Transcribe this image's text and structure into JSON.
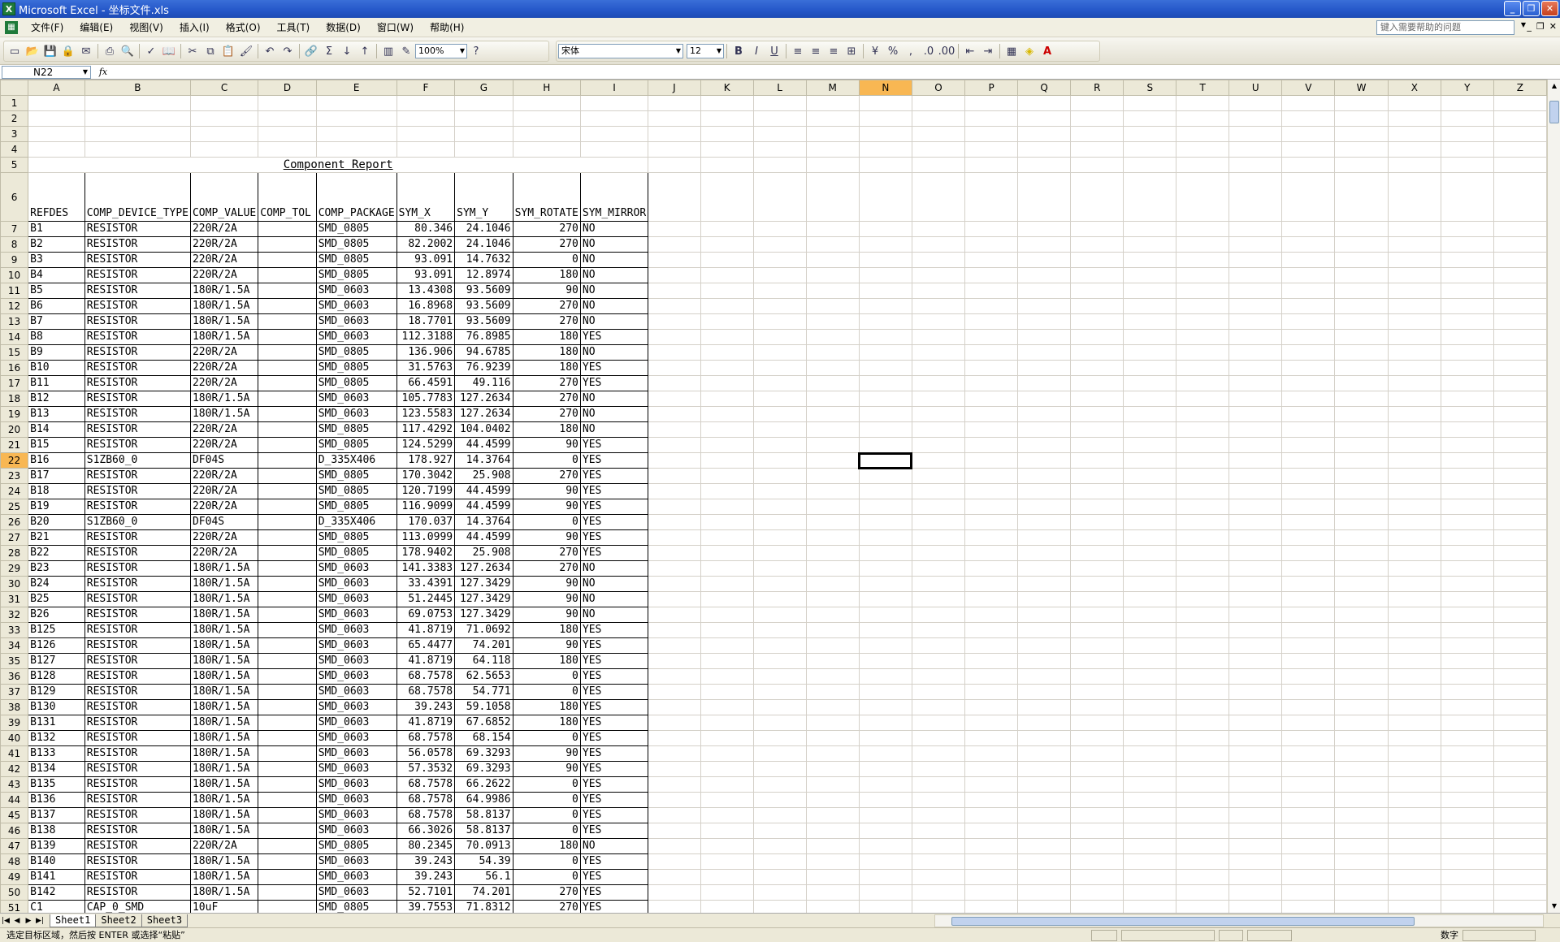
{
  "window": {
    "title": "Microsoft Excel - 坐标文件.xls",
    "app_icon": "excel-icon"
  },
  "menus": [
    "文件(F)",
    "编辑(E)",
    "视图(V)",
    "插入(I)",
    "格式(O)",
    "工具(T)",
    "数据(D)",
    "窗口(W)",
    "帮助(H)"
  ],
  "help_placeholder": "键入需要帮助的问题",
  "toolbar": {
    "zoom": "100%",
    "font": "宋体",
    "size": "12"
  },
  "formula": {
    "name_box": "N22",
    "fx": "fx",
    "value": ""
  },
  "columns": [
    "A",
    "B",
    "C",
    "D",
    "E",
    "F",
    "G",
    "H",
    "I",
    "J",
    "K",
    "L",
    "M",
    "N",
    "O",
    "P",
    "Q",
    "R",
    "S",
    "T",
    "U",
    "V",
    "W",
    "X",
    "Y",
    "Z"
  ],
  "selected_column": "N",
  "selected_row": 22,
  "report_title": "Component Report",
  "headers": [
    "REFDES",
    "COMP_DEVICE_TYPE",
    "COMP_VALUE",
    "COMP_TOL",
    "COMP_PACKAGE",
    "SYM_X",
    "SYM_Y",
    "SYM_ROTATE",
    "SYM_MIRROR"
  ],
  "rows": [
    [
      "B1",
      "RESISTOR",
      "220R/2A",
      "",
      "SMD_0805",
      "80.346",
      "24.1046",
      "270",
      "NO"
    ],
    [
      "B2",
      "RESISTOR",
      "220R/2A",
      "",
      "SMD_0805",
      "82.2002",
      "24.1046",
      "270",
      "NO"
    ],
    [
      "B3",
      "RESISTOR",
      "220R/2A",
      "",
      "SMD_0805",
      "93.091",
      "14.7632",
      "0",
      "NO"
    ],
    [
      "B4",
      "RESISTOR",
      "220R/2A",
      "",
      "SMD_0805",
      "93.091",
      "12.8974",
      "180",
      "NO"
    ],
    [
      "B5",
      "RESISTOR",
      "180R/1.5A",
      "",
      "SMD_0603",
      "13.4308",
      "93.5609",
      "90",
      "NO"
    ],
    [
      "B6",
      "RESISTOR",
      "180R/1.5A",
      "",
      "SMD_0603",
      "16.8968",
      "93.5609",
      "270",
      "NO"
    ],
    [
      "B7",
      "RESISTOR",
      "180R/1.5A",
      "",
      "SMD_0603",
      "18.7701",
      "93.5609",
      "270",
      "NO"
    ],
    [
      "B8",
      "RESISTOR",
      "180R/1.5A",
      "",
      "SMD_0603",
      "112.3188",
      "76.8985",
      "180",
      "YES"
    ],
    [
      "B9",
      "RESISTOR",
      "220R/2A",
      "",
      "SMD_0805",
      "136.906",
      "94.6785",
      "180",
      "NO"
    ],
    [
      "B10",
      "RESISTOR",
      "220R/2A",
      "",
      "SMD_0805",
      "31.5763",
      "76.9239",
      "180",
      "YES"
    ],
    [
      "B11",
      "RESISTOR",
      "220R/2A",
      "",
      "SMD_0805",
      "66.4591",
      "49.116",
      "270",
      "YES"
    ],
    [
      "B12",
      "RESISTOR",
      "180R/1.5A",
      "",
      "SMD_0603",
      "105.7783",
      "127.2634",
      "270",
      "NO"
    ],
    [
      "B13",
      "RESISTOR",
      "180R/1.5A",
      "",
      "SMD_0603",
      "123.5583",
      "127.2634",
      "270",
      "NO"
    ],
    [
      "B14",
      "RESISTOR",
      "220R/2A",
      "",
      "SMD_0805",
      "117.4292",
      "104.0402",
      "180",
      "NO"
    ],
    [
      "B15",
      "RESISTOR",
      "220R/2A",
      "",
      "SMD_0805",
      "124.5299",
      "44.4599",
      "90",
      "YES"
    ],
    [
      "B16",
      "S1ZB60_0",
      "DF04S",
      "",
      "D_335X406",
      "178.927",
      "14.3764",
      "0",
      "YES"
    ],
    [
      "B17",
      "RESISTOR",
      "220R/2A",
      "",
      "SMD_0805",
      "170.3042",
      "25.908",
      "270",
      "YES"
    ],
    [
      "B18",
      "RESISTOR",
      "220R/2A",
      "",
      "SMD_0805",
      "120.7199",
      "44.4599",
      "90",
      "YES"
    ],
    [
      "B19",
      "RESISTOR",
      "220R/2A",
      "",
      "SMD_0805",
      "116.9099",
      "44.4599",
      "90",
      "YES"
    ],
    [
      "B20",
      "S1ZB60_0",
      "DF04S",
      "",
      "D_335X406",
      "170.037",
      "14.3764",
      "0",
      "YES"
    ],
    [
      "B21",
      "RESISTOR",
      "220R/2A",
      "",
      "SMD_0805",
      "113.0999",
      "44.4599",
      "90",
      "YES"
    ],
    [
      "B22",
      "RESISTOR",
      "220R/2A",
      "",
      "SMD_0805",
      "178.9402",
      "25.908",
      "270",
      "YES"
    ],
    [
      "B23",
      "RESISTOR",
      "180R/1.5A",
      "",
      "SMD_0603",
      "141.3383",
      "127.2634",
      "270",
      "NO"
    ],
    [
      "B24",
      "RESISTOR",
      "180R/1.5A",
      "",
      "SMD_0603",
      "33.4391",
      "127.3429",
      "90",
      "NO"
    ],
    [
      "B25",
      "RESISTOR",
      "180R/1.5A",
      "",
      "SMD_0603",
      "51.2445",
      "127.3429",
      "90",
      "NO"
    ],
    [
      "B26",
      "RESISTOR",
      "180R/1.5A",
      "",
      "SMD_0603",
      "69.0753",
      "127.3429",
      "90",
      "NO"
    ],
    [
      "B125",
      "RESISTOR",
      "180R/1.5A",
      "",
      "SMD_0603",
      "41.8719",
      "71.0692",
      "180",
      "YES"
    ],
    [
      "B126",
      "RESISTOR",
      "180R/1.5A",
      "",
      "SMD_0603",
      "65.4477",
      "74.201",
      "90",
      "YES"
    ],
    [
      "B127",
      "RESISTOR",
      "180R/1.5A",
      "",
      "SMD_0603",
      "41.8719",
      "64.118",
      "180",
      "YES"
    ],
    [
      "B128",
      "RESISTOR",
      "180R/1.5A",
      "",
      "SMD_0603",
      "68.7578",
      "62.5653",
      "0",
      "YES"
    ],
    [
      "B129",
      "RESISTOR",
      "180R/1.5A",
      "",
      "SMD_0603",
      "68.7578",
      "54.771",
      "0",
      "YES"
    ],
    [
      "B130",
      "RESISTOR",
      "180R/1.5A",
      "",
      "SMD_0603",
      "39.243",
      "59.1058",
      "180",
      "YES"
    ],
    [
      "B131",
      "RESISTOR",
      "180R/1.5A",
      "",
      "SMD_0603",
      "41.8719",
      "67.6852",
      "180",
      "YES"
    ],
    [
      "B132",
      "RESISTOR",
      "180R/1.5A",
      "",
      "SMD_0603",
      "68.7578",
      "68.154",
      "0",
      "YES"
    ],
    [
      "B133",
      "RESISTOR",
      "180R/1.5A",
      "",
      "SMD_0603",
      "56.0578",
      "69.3293",
      "90",
      "YES"
    ],
    [
      "B134",
      "RESISTOR",
      "180R/1.5A",
      "",
      "SMD_0603",
      "57.3532",
      "69.3293",
      "90",
      "YES"
    ],
    [
      "B135",
      "RESISTOR",
      "180R/1.5A",
      "",
      "SMD_0603",
      "68.7578",
      "66.2622",
      "0",
      "YES"
    ],
    [
      "B136",
      "RESISTOR",
      "180R/1.5A",
      "",
      "SMD_0603",
      "68.7578",
      "64.9986",
      "0",
      "YES"
    ],
    [
      "B137",
      "RESISTOR",
      "180R/1.5A",
      "",
      "SMD_0603",
      "68.7578",
      "58.8137",
      "0",
      "YES"
    ],
    [
      "B138",
      "RESISTOR",
      "180R/1.5A",
      "",
      "SMD_0603",
      "66.3026",
      "58.8137",
      "0",
      "YES"
    ],
    [
      "B139",
      "RESISTOR",
      "220R/2A",
      "",
      "SMD_0805",
      "80.2345",
      "70.0913",
      "180",
      "NO"
    ],
    [
      "B140",
      "RESISTOR",
      "180R/1.5A",
      "",
      "SMD_0603",
      "39.243",
      "54.39",
      "0",
      "YES"
    ],
    [
      "B141",
      "RESISTOR",
      "180R/1.5A",
      "",
      "SMD_0603",
      "39.243",
      "56.1",
      "0",
      "YES"
    ],
    [
      "B142",
      "RESISTOR",
      "180R/1.5A",
      "",
      "SMD_0603",
      "52.7101",
      "74.201",
      "270",
      "YES"
    ],
    [
      "C1",
      "CAP_0_SMD",
      "10uF",
      "",
      "SMD_0805",
      "39.7553",
      "71.8312",
      "270",
      "YES"
    ]
  ],
  "sheets": [
    "Sheet1",
    "Sheet2",
    "Sheet3"
  ],
  "status": {
    "message": "选定目标区域，然后按 ENTER 或选择“粘贴”",
    "mode": "数字"
  }
}
